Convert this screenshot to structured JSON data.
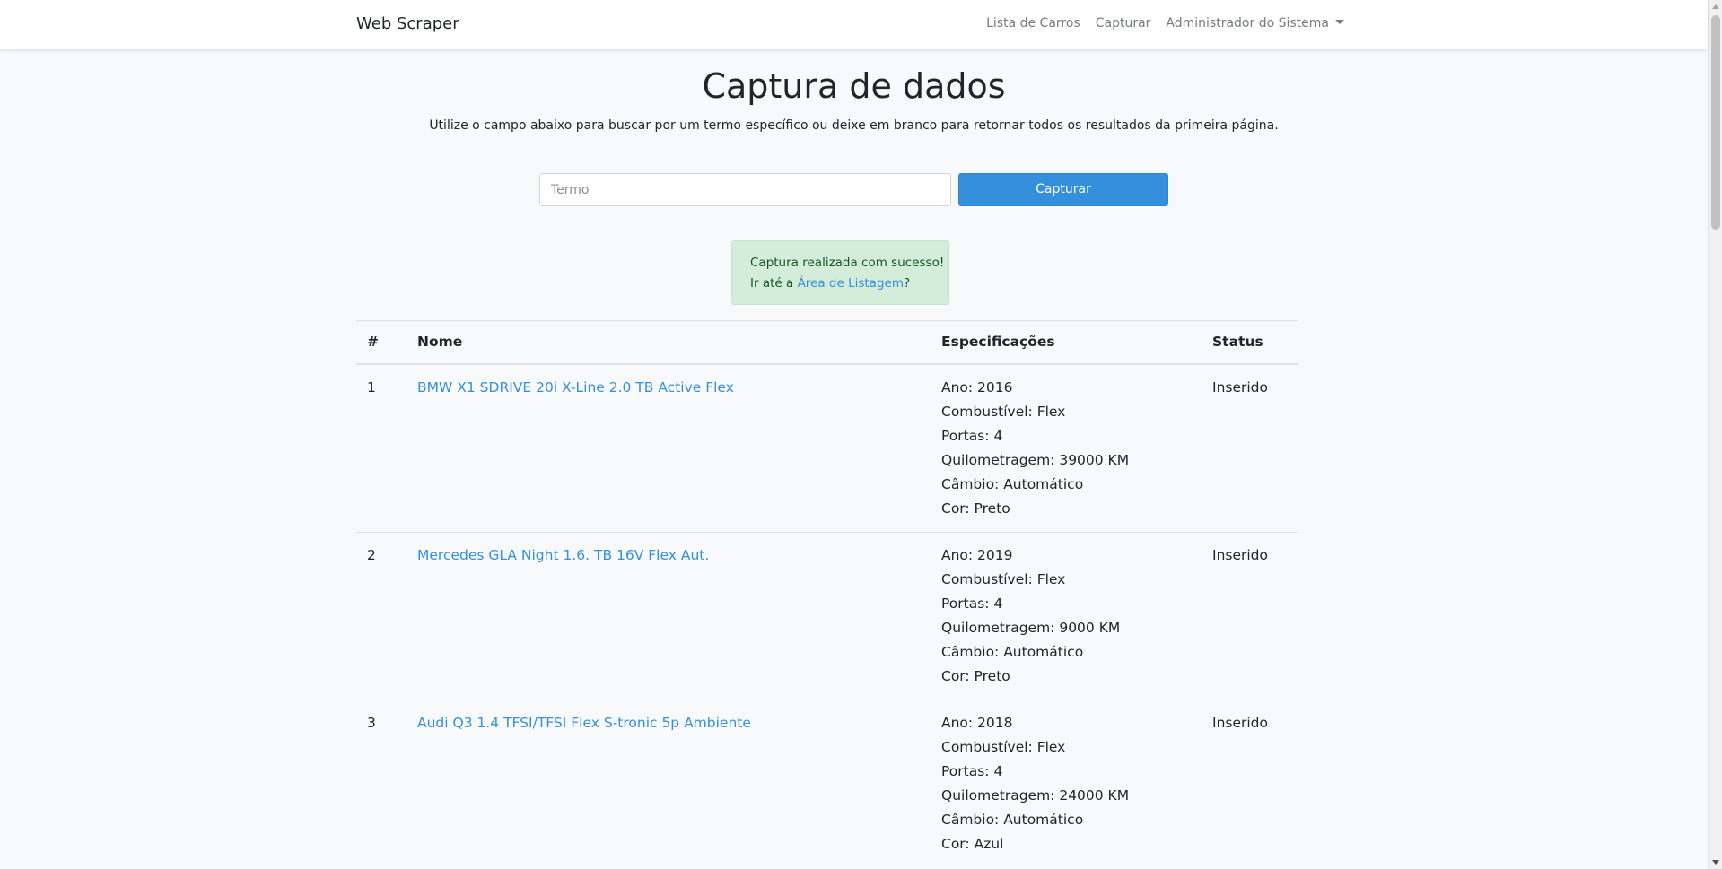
{
  "navbar": {
    "brand": "Web Scraper",
    "links": [
      "Lista de Carros",
      "Capturar"
    ],
    "user_menu": "Administrador do Sistema"
  },
  "main": {
    "title": "Captura de dados",
    "lead": "Utilize o campo abaixo para buscar por um termo específico ou deixe em branco para retornar todos os resultados da primeira página.",
    "search": {
      "placeholder": "Termo",
      "value": ""
    },
    "capture_button": "Capturar",
    "alert": {
      "line1": "Captura realizada com sucesso!",
      "line2_prefix": "Ir até a ",
      "link": "Área de Listagem",
      "line2_suffix": "?"
    }
  },
  "table": {
    "headers": [
      "#",
      "Nome",
      "Especificações",
      "Status"
    ],
    "rows": [
      {
        "num": "1",
        "name": "BMW X1 SDRIVE 20i X-Line 2.0 TB Active Flex",
        "specs": [
          "Ano: 2016",
          "Combustível: Flex",
          "Portas: 4",
          "Quilometragem: 39000 KM",
          "Câmbio: Automático",
          "Cor: Preto"
        ],
        "status": "Inserido"
      },
      {
        "num": "2",
        "name": "Mercedes GLA Night 1.6. TB 16V Flex Aut.",
        "specs": [
          "Ano: 2019",
          "Combustível: Flex",
          "Portas: 4",
          "Quilometragem: 9000 KM",
          "Câmbio: Automático",
          "Cor: Preto"
        ],
        "status": "Inserido"
      },
      {
        "num": "3",
        "name": "Audi Q3 1.4 TFSI/TFSI Flex S-tronic 5p Ambiente",
        "specs": [
          "Ano: 2018",
          "Combustível: Flex",
          "Portas: 4",
          "Quilometragem: 24000 KM",
          "Câmbio: Automático",
          "Cor: Azul"
        ],
        "status": "Inserido"
      }
    ]
  }
}
